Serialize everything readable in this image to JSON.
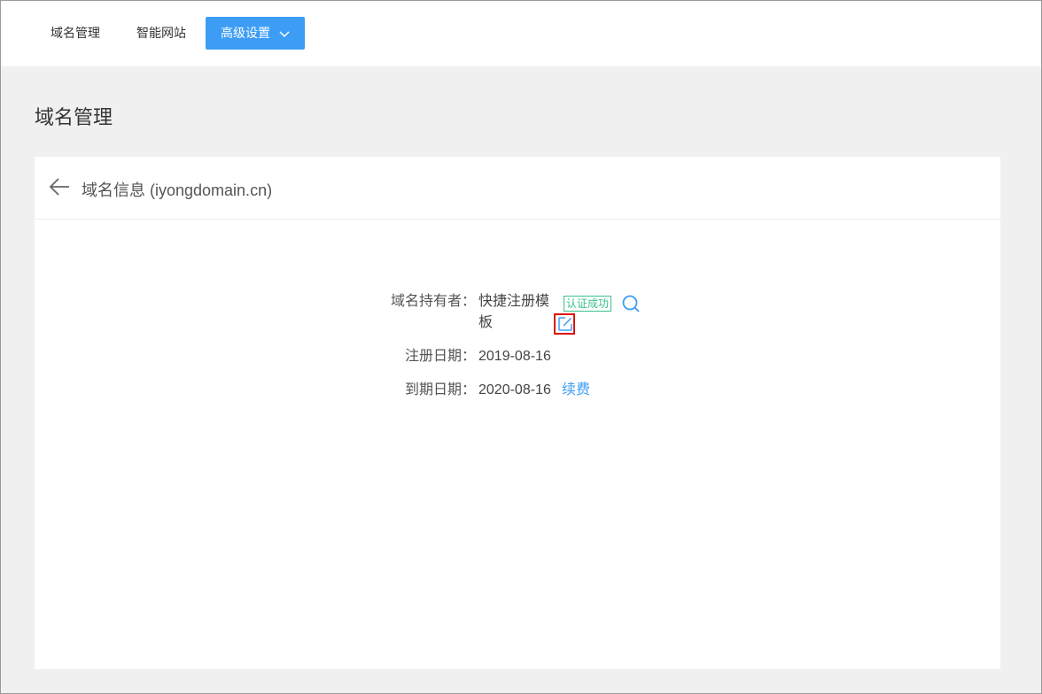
{
  "nav": {
    "domain_mgmt": "域名管理",
    "smart_site": "智能网站",
    "advanced": "高级设置"
  },
  "page": {
    "title": "域名管理"
  },
  "card": {
    "title": "域名信息 (iyongdomain.cn)",
    "owner_label": "域名持有者：",
    "owner_value": "快捷注册模板",
    "badge": "认证成功",
    "reg_label": "注册日期：",
    "reg_value": "2019-08-16",
    "exp_label": "到期日期：",
    "exp_value": "2020-08-16",
    "renew": "续费"
  },
  "colors": {
    "accent": "#3d9df5",
    "success": "#3ac28a",
    "highlight": "#e01010"
  },
  "icons": [
    "chevron-down-icon",
    "back-arrow-icon",
    "search-icon",
    "edit-icon"
  ]
}
